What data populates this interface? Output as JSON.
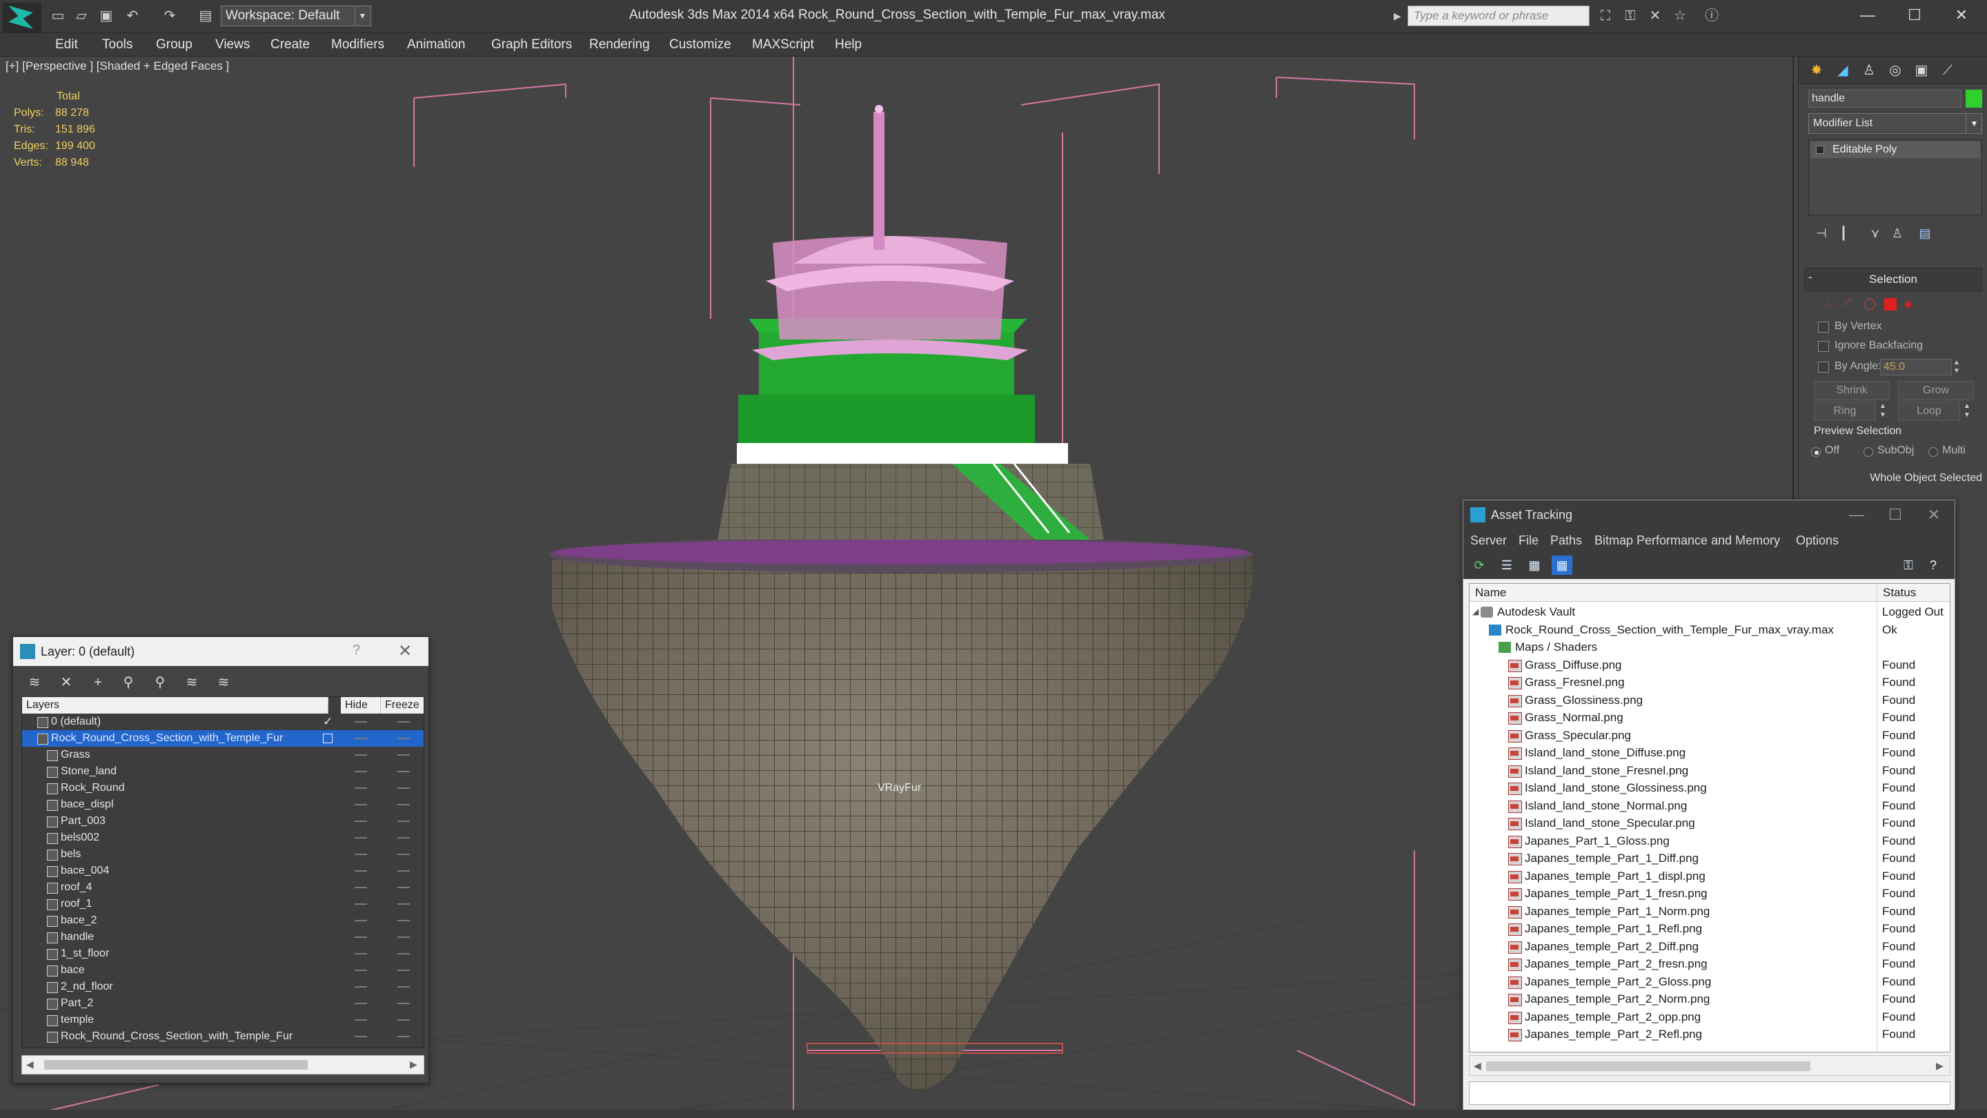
{
  "titlebar": {
    "workspace": "Workspace: Default",
    "app_title": "Autodesk 3ds Max  2014 x64      Rock_Round_Cross_Section_with_Temple_Fur_max_vray.max",
    "search_placeholder": "Type a keyword or phrase",
    "minimize": "—",
    "maximize": "☐",
    "close": "✕"
  },
  "menu": [
    "Edit",
    "Tools",
    "Group",
    "Views",
    "Create",
    "Modifiers",
    "Animation",
    "Graph Editors",
    "Rendering",
    "Customize",
    "MAXScript",
    "Help"
  ],
  "viewport": {
    "label": "[+] [Perspective ] [Shaded + Edged Faces ]",
    "stats_header": "Total",
    "stats": [
      {
        "key": "Polys:",
        "value": "88 278"
      },
      {
        "key": "Tris:",
        "value": "151 896"
      },
      {
        "key": "Edges:",
        "value": "199 400"
      },
      {
        "key": "Verts:",
        "value": "88 948"
      }
    ],
    "fur_label": "VRayFur"
  },
  "command_panel": {
    "object_name": "handle",
    "object_color": "#2ed12e",
    "modifier_list": "Modifier List",
    "stack_item": "Editable Poly",
    "selection_title": "Selection",
    "by_vertex": "By Vertex",
    "ignore_backfacing": "Ignore Backfacing",
    "by_angle": "By Angle:",
    "angle_value": "45.0",
    "shrink": "Shrink",
    "grow": "Grow",
    "ring": "Ring",
    "loop": "Loop",
    "preview_selection": "Preview Selection",
    "preview_off": "Off",
    "preview_subobj": "SubObj",
    "preview_multi": "Multi",
    "whole_object": "Whole Object Selected"
  },
  "layer_dialog": {
    "title": "Layer: 0 (default)",
    "help": "?",
    "close": "✕",
    "columns": {
      "layers": "Layers",
      "hide": "Hide",
      "freeze": "Freeze"
    },
    "rows": [
      {
        "name": "0 (default)",
        "level": 1,
        "checked": true,
        "selected": false
      },
      {
        "name": "Rock_Round_Cross_Section_with_Temple_Fur",
        "level": 1,
        "checked": false,
        "selected": true
      },
      {
        "name": "Grass",
        "level": 2
      },
      {
        "name": "Stone_land",
        "level": 2
      },
      {
        "name": "Rock_Round",
        "level": 2
      },
      {
        "name": "bace_displ",
        "level": 2
      },
      {
        "name": "Part_003",
        "level": 2
      },
      {
        "name": "bels002",
        "level": 2
      },
      {
        "name": "bels",
        "level": 2
      },
      {
        "name": "bace_004",
        "level": 2
      },
      {
        "name": "roof_4",
        "level": 2
      },
      {
        "name": "roof_1",
        "level": 2
      },
      {
        "name": "bace_2",
        "level": 2
      },
      {
        "name": "handle",
        "level": 2
      },
      {
        "name": "1_st_floor",
        "level": 2
      },
      {
        "name": "bace",
        "level": 2
      },
      {
        "name": "2_nd_floor",
        "level": 2
      },
      {
        "name": "Part_2",
        "level": 2
      },
      {
        "name": "temple",
        "level": 2
      },
      {
        "name": "Rock_Round_Cross_Section_with_Temple_Fur",
        "level": 2
      }
    ]
  },
  "asset_dialog": {
    "title": "Asset Tracking",
    "menu": [
      "Server",
      "File",
      "Paths",
      "Bitmap Performance and Memory",
      "Options"
    ],
    "columns": {
      "name": "Name",
      "status": "Status"
    },
    "rows": [
      {
        "name": "Autodesk Vault",
        "status": "Logged Out",
        "level": 0,
        "icon": "vault"
      },
      {
        "name": "Rock_Round_Cross_Section_with_Temple_Fur_max_vray.max",
        "status": "Ok",
        "level": 1,
        "icon": "max"
      },
      {
        "name": "Maps / Shaders",
        "status": "",
        "level": 2,
        "icon": "folder"
      },
      {
        "name": "Grass_Diffuse.png",
        "status": "Found",
        "level": 3,
        "icon": "png"
      },
      {
        "name": "Grass_Fresnel.png",
        "status": "Found",
        "level": 3,
        "icon": "png"
      },
      {
        "name": "Grass_Glossiness.png",
        "status": "Found",
        "level": 3,
        "icon": "png"
      },
      {
        "name": "Grass_Normal.png",
        "status": "Found",
        "level": 3,
        "icon": "png"
      },
      {
        "name": "Grass_Specular.png",
        "status": "Found",
        "level": 3,
        "icon": "png"
      },
      {
        "name": "Island_land_stone_Diffuse.png",
        "status": "Found",
        "level": 3,
        "icon": "png"
      },
      {
        "name": "Island_land_stone_Fresnel.png",
        "status": "Found",
        "level": 3,
        "icon": "png"
      },
      {
        "name": "Island_land_stone_Glossiness.png",
        "status": "Found",
        "level": 3,
        "icon": "png"
      },
      {
        "name": "Island_land_stone_Normal.png",
        "status": "Found",
        "level": 3,
        "icon": "png"
      },
      {
        "name": "Island_land_stone_Specular.png",
        "status": "Found",
        "level": 3,
        "icon": "png"
      },
      {
        "name": "Japanes_Part_1_Gloss.png",
        "status": "Found",
        "level": 3,
        "icon": "png"
      },
      {
        "name": "Japanes_temple_Part_1_Diff.png",
        "status": "Found",
        "level": 3,
        "icon": "png"
      },
      {
        "name": "Japanes_temple_Part_1_displ.png",
        "status": "Found",
        "level": 3,
        "icon": "png"
      },
      {
        "name": "Japanes_temple_Part_1_fresn.png",
        "status": "Found",
        "level": 3,
        "icon": "png"
      },
      {
        "name": "Japanes_temple_Part_1_Norm.png",
        "status": "Found",
        "level": 3,
        "icon": "png"
      },
      {
        "name": "Japanes_temple_Part_1_Refl.png",
        "status": "Found",
        "level": 3,
        "icon": "png"
      },
      {
        "name": "Japanes_temple_Part_2_Diff.png",
        "status": "Found",
        "level": 3,
        "icon": "png"
      },
      {
        "name": "Japanes_temple_Part_2_fresn.png",
        "status": "Found",
        "level": 3,
        "icon": "png"
      },
      {
        "name": "Japanes_temple_Part_2_Gloss.png",
        "status": "Found",
        "level": 3,
        "icon": "png"
      },
      {
        "name": "Japanes_temple_Part_2_Norm.png",
        "status": "Found",
        "level": 3,
        "icon": "png"
      },
      {
        "name": "Japanes_temple_Part_2_opp.png",
        "status": "Found",
        "level": 3,
        "icon": "png"
      },
      {
        "name": "Japanes_temple_Part_2_Refl.png",
        "status": "Found",
        "level": 3,
        "icon": "png"
      }
    ]
  }
}
